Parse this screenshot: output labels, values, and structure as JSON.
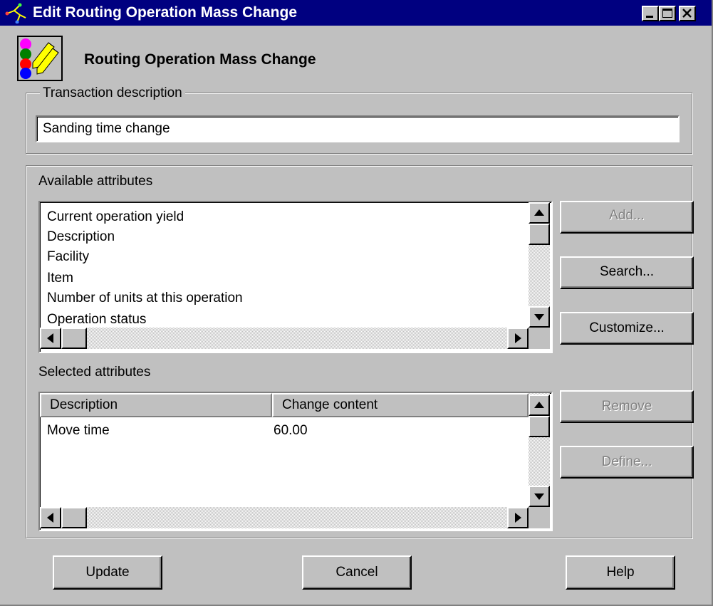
{
  "window": {
    "title": "Edit Routing Operation Mass Change",
    "heading": "Routing Operation Mass Change"
  },
  "transaction": {
    "legend": "Transaction description",
    "value": "Sanding time change"
  },
  "available": {
    "label": "Available attributes",
    "items": [
      "Current operation yield",
      "Description",
      "Facility",
      "Item",
      "Number of units at this operation",
      "Operation status"
    ]
  },
  "selected": {
    "label": "Selected attributes",
    "columns": [
      "Description",
      "Change content"
    ],
    "rows": [
      {
        "description": "Move time",
        "content": "60.00"
      }
    ]
  },
  "buttons": {
    "add": "Add...",
    "search": "Search...",
    "customize": "Customize...",
    "remove": "Remove",
    "define": "Define...",
    "update": "Update",
    "cancel": "Cancel",
    "help": "Help"
  },
  "icons": {
    "title": "routing-tree-icon",
    "app": "mass-change-icon"
  }
}
